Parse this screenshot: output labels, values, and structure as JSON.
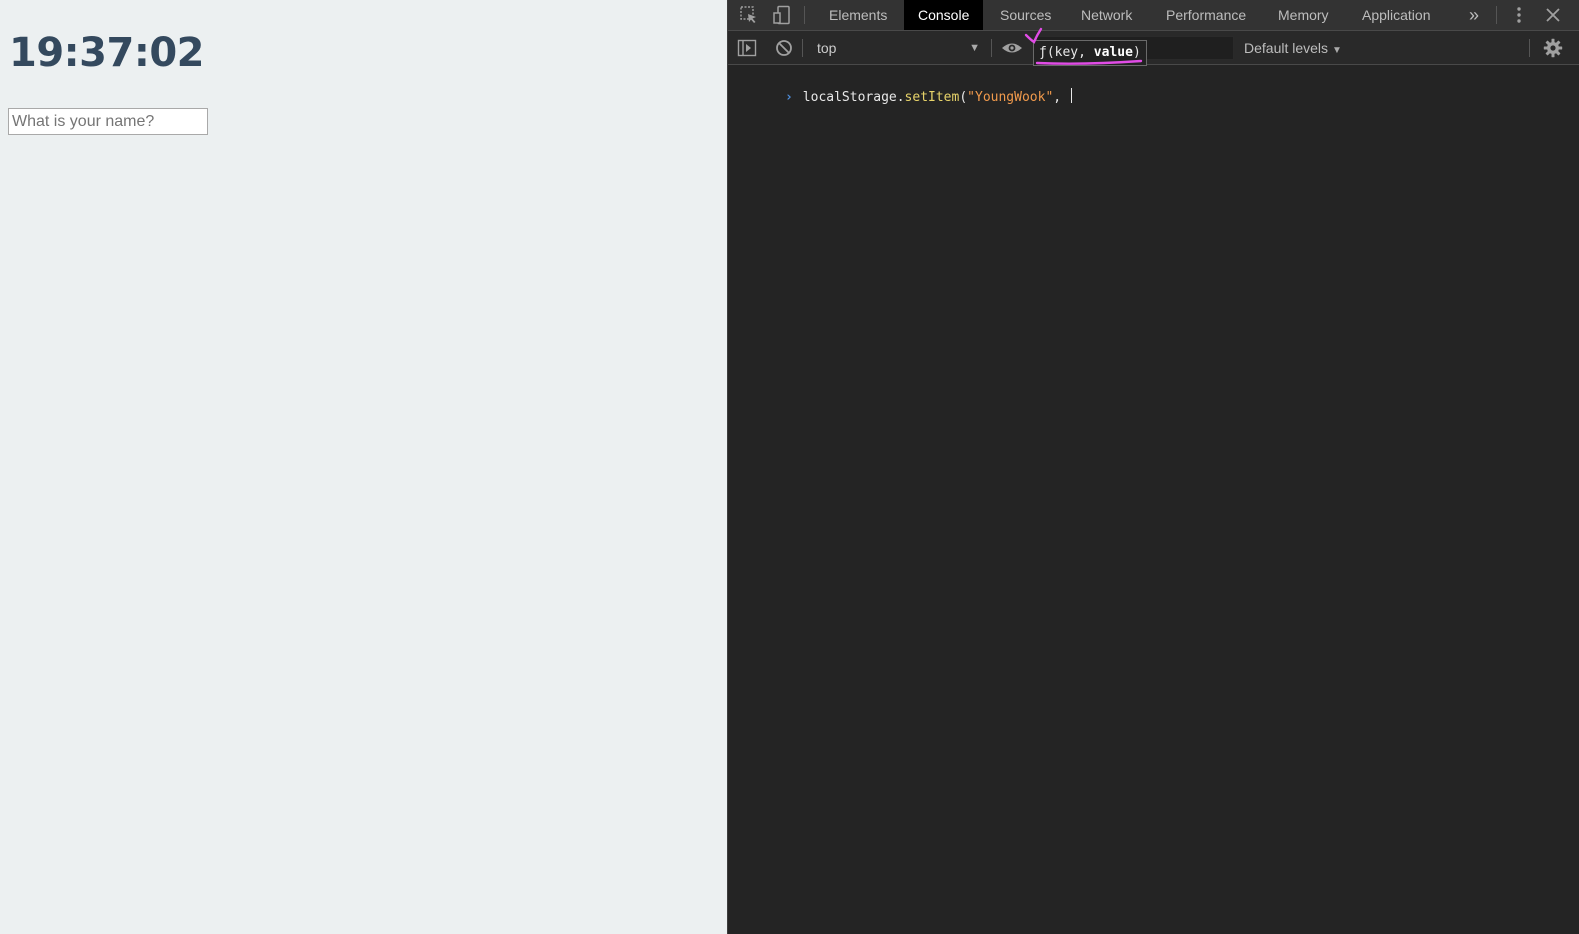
{
  "page": {
    "clock": "19:37:02",
    "name_input": {
      "placeholder": "What is your name?",
      "value": ""
    }
  },
  "devtools": {
    "tabs": [
      "Elements",
      "Console",
      "Sources",
      "Network",
      "Performance",
      "Memory",
      "Application"
    ],
    "active_tab": "Console",
    "more_tabs_label": "»",
    "context": "top",
    "levels_label": "Default levels",
    "tooltip": {
      "prefix": "ƒ(",
      "param1": "key",
      "comma": ", ",
      "param2": "value",
      "suffix": ")"
    },
    "console": {
      "code_object": "localStorage.",
      "code_method": "setItem",
      "code_open": "(",
      "code_string": "\"YoungWook\"",
      "code_rest": ", "
    },
    "icons": [
      "inspect-icon",
      "device-toggle-icon",
      "sidebar-toggle-icon",
      "clear-console-icon",
      "eye-icon",
      "kebab-menu-icon",
      "close-icon",
      "settings-gear-icon"
    ],
    "accent_color": "#4f8fdd",
    "annotation_color": "#e14ce6"
  }
}
